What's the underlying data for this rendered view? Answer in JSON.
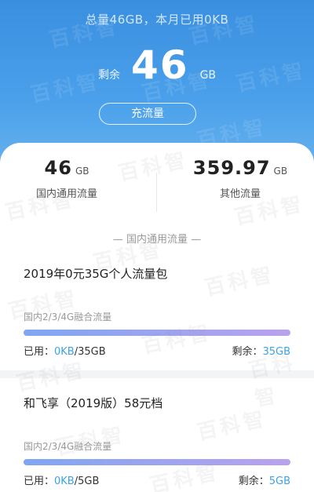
{
  "header": {
    "summary": "总量46GB，本月已用0KB",
    "remaining_label": "剩余",
    "remaining_value": "46",
    "remaining_unit": "GB",
    "recharge_label": "充流量"
  },
  "stats": {
    "domestic": {
      "value": "46",
      "unit": "GB",
      "label": "国内通用流量"
    },
    "other": {
      "value": "359.97",
      "unit": "GB",
      "label": "其他流量"
    }
  },
  "section_title": "— 国内通用流量 —",
  "packages": [
    {
      "name": "2019年0元35G个人流量包",
      "type": "国内2/3/4G融合流量",
      "used_label": "已用：",
      "used_value": "0KB",
      "total": "/35GB",
      "remaining_label": "剩余：",
      "remaining_value": "35GB",
      "remaining_fraction": 1.0
    },
    {
      "name": "和飞享（2019版）58元档",
      "type": "国内2/3/4G融合流量",
      "used_label": "已用：",
      "used_value": "0KB",
      "total": "/5GB",
      "remaining_label": "剩余：",
      "remaining_value": "5GB",
      "remaining_fraction": 1.0
    }
  ],
  "watermark": "百科智",
  "colors": {
    "header_top": "#3a8fe0",
    "header_bottom": "#6bb4ef",
    "bar_start": "#7fa6f2",
    "bar_end": "#b9a2ee",
    "highlight": "#3aa3e0"
  }
}
